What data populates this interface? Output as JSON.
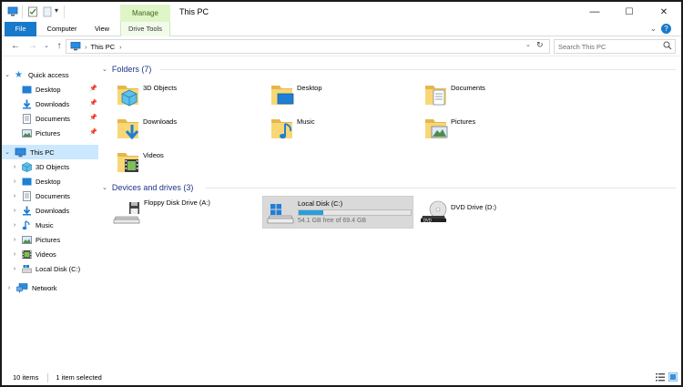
{
  "window": {
    "title": "This PC",
    "context_tab": "Manage",
    "controls": {
      "minimize": "—",
      "maximize": "☐",
      "close": "✕"
    }
  },
  "ribbon": {
    "tabs": [
      "File",
      "Computer",
      "View",
      "Drive Tools"
    ],
    "help": "?"
  },
  "address": {
    "path": [
      "This PC"
    ],
    "search_placeholder": "Search This PC"
  },
  "sidebar": {
    "quick_access": {
      "label": "Quick access",
      "items": [
        {
          "label": "Desktop",
          "icon": "desktop-icon",
          "pinned": true
        },
        {
          "label": "Downloads",
          "icon": "downloads-icon",
          "pinned": true
        },
        {
          "label": "Documents",
          "icon": "documents-icon",
          "pinned": true
        },
        {
          "label": "Pictures",
          "icon": "pictures-icon",
          "pinned": true
        }
      ]
    },
    "this_pc": {
      "label": "This PC",
      "items": [
        {
          "label": "3D Objects",
          "icon": "3d-objects-icon"
        },
        {
          "label": "Desktop",
          "icon": "desktop-icon"
        },
        {
          "label": "Documents",
          "icon": "documents-icon"
        },
        {
          "label": "Downloads",
          "icon": "downloads-icon"
        },
        {
          "label": "Music",
          "icon": "music-icon"
        },
        {
          "label": "Pictures",
          "icon": "pictures-icon"
        },
        {
          "label": "Videos",
          "icon": "videos-icon"
        },
        {
          "label": "Local Disk (C:)",
          "icon": "local-disk-icon"
        }
      ]
    },
    "network": {
      "label": "Network"
    }
  },
  "folders": {
    "heading": "Folders (7)",
    "items": [
      {
        "label": "3D Objects",
        "icon": "3d-objects-icon"
      },
      {
        "label": "Desktop",
        "icon": "desktop-icon"
      },
      {
        "label": "Documents",
        "icon": "documents-icon"
      },
      {
        "label": "Downloads",
        "icon": "downloads-icon"
      },
      {
        "label": "Music",
        "icon": "music-icon"
      },
      {
        "label": "Pictures",
        "icon": "pictures-icon"
      },
      {
        "label": "Videos",
        "icon": "videos-icon"
      }
    ]
  },
  "drives": {
    "heading": "Devices and drives (3)",
    "items": [
      {
        "label": "Floppy Disk Drive (A:)",
        "icon": "floppy-drive-icon"
      },
      {
        "label": "Local Disk (C:)",
        "icon": "local-disk-icon",
        "free_text": "54.1 GB free of 69.4 GB",
        "used_fraction": 0.22,
        "selected": true
      },
      {
        "label": "DVD Drive (D:)",
        "icon": "dvd-drive-icon"
      }
    ]
  },
  "status": {
    "items_count": "10 items",
    "selected": "1 item selected"
  },
  "colors": {
    "accent": "#1979ca",
    "selection": "#cce8ff",
    "manage_tab": "#dff5c8",
    "group_heading": "#1e3287",
    "drive_bar": "#26a0da",
    "folder_yellow": "#f8d775"
  }
}
